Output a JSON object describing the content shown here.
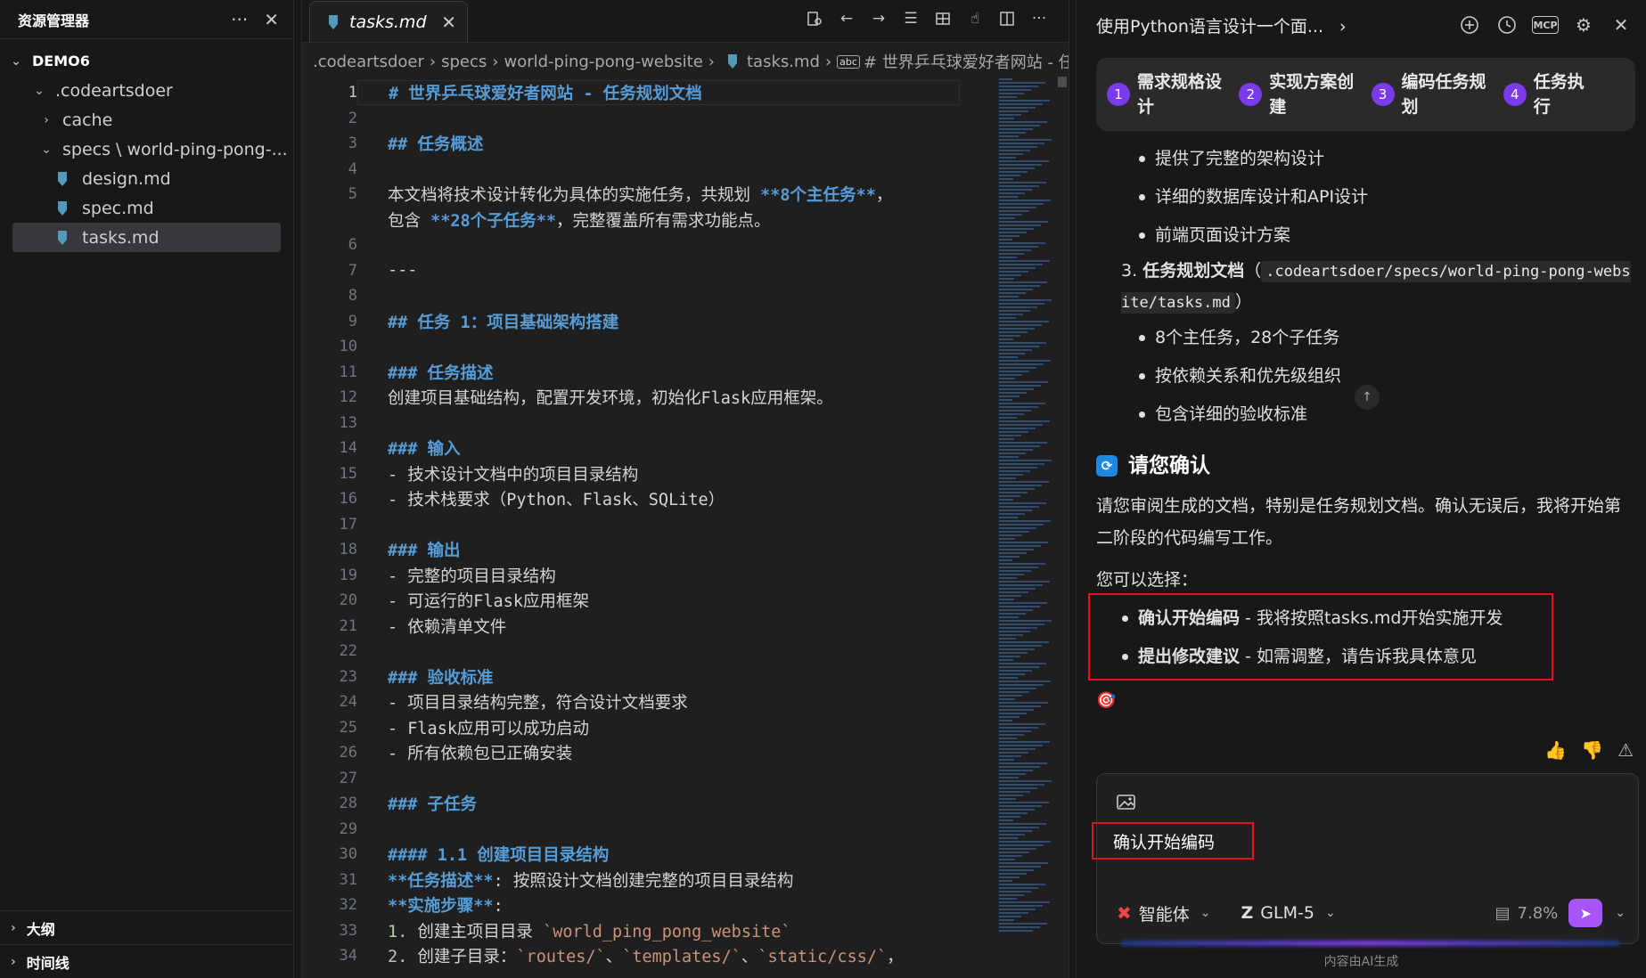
{
  "explorer": {
    "title": "资源管理器",
    "more": "···",
    "close": "✕",
    "root": "DEMO6",
    "items": [
      {
        "label": ".codeartsdoer",
        "kind": "folder-open",
        "indent": 1
      },
      {
        "label": "cache",
        "kind": "folder-closed",
        "indent": 2
      },
      {
        "label": "specs \\ world-ping-pong-...",
        "kind": "folder-open",
        "indent": 2
      },
      {
        "label": "design.md",
        "kind": "file",
        "indent": 3
      },
      {
        "label": "spec.md",
        "kind": "file",
        "indent": 3
      },
      {
        "label": "tasks.md",
        "kind": "file",
        "indent": 3,
        "selected": true
      }
    ],
    "outline": "大纲",
    "timeline": "时间线"
  },
  "editor": {
    "tab_label": "tasks.md",
    "breadcrumb": [
      ".codeartsdoer",
      "specs",
      "world-ping-pong-website",
      "tasks.md",
      "# 世界乒乓球爱好者网站 - 任务"
    ],
    "lines": [
      {
        "n": "1",
        "segs": [
          {
            "t": "# 世界乒乓球爱好者网站 - 任务规划文档",
            "c": "h"
          }
        ]
      },
      {
        "n": "2",
        "segs": []
      },
      {
        "n": "3",
        "segs": [
          {
            "t": "## 任务概述",
            "c": "h"
          }
        ]
      },
      {
        "n": "4",
        "segs": []
      },
      {
        "n": "5",
        "segs": [
          {
            "t": "本文档将技术设计转化为具体的实施任务，共规划 ",
            "c": ""
          },
          {
            "t": "**8个主任务**",
            "c": "b"
          },
          {
            "t": "，",
            "c": ""
          }
        ]
      },
      {
        "n": "",
        "segs": [
          {
            "t": "包含 ",
            "c": ""
          },
          {
            "t": "**28个子任务**",
            "c": "b"
          },
          {
            "t": "，完整覆盖所有需求功能点。",
            "c": ""
          }
        ]
      },
      {
        "n": "6",
        "segs": []
      },
      {
        "n": "7",
        "segs": [
          {
            "t": "---",
            "c": ""
          }
        ]
      },
      {
        "n": "8",
        "segs": []
      },
      {
        "n": "9",
        "segs": [
          {
            "t": "## 任务 1：项目基础架构搭建",
            "c": "h"
          }
        ]
      },
      {
        "n": "10",
        "segs": []
      },
      {
        "n": "11",
        "segs": [
          {
            "t": "### 任务描述",
            "c": "h"
          }
        ]
      },
      {
        "n": "12",
        "segs": [
          {
            "t": "创建项目基础结构，配置开发环境，初始化Flask应用框架。",
            "c": ""
          }
        ]
      },
      {
        "n": "13",
        "segs": []
      },
      {
        "n": "14",
        "segs": [
          {
            "t": "### 输入",
            "c": "h"
          }
        ]
      },
      {
        "n": "15",
        "segs": [
          {
            "t": "- 技术设计文档中的项目目录结构",
            "c": ""
          }
        ]
      },
      {
        "n": "16",
        "segs": [
          {
            "t": "- 技术栈要求（Python、Flask、SQLite）",
            "c": ""
          }
        ]
      },
      {
        "n": "17",
        "segs": []
      },
      {
        "n": "18",
        "segs": [
          {
            "t": "### 输出",
            "c": "h"
          }
        ]
      },
      {
        "n": "19",
        "segs": [
          {
            "t": "- 完整的项目目录结构",
            "c": ""
          }
        ]
      },
      {
        "n": "20",
        "segs": [
          {
            "t": "- 可运行的Flask应用框架",
            "c": ""
          }
        ]
      },
      {
        "n": "21",
        "segs": [
          {
            "t": "- 依赖清单文件",
            "c": ""
          }
        ]
      },
      {
        "n": "22",
        "segs": []
      },
      {
        "n": "23",
        "segs": [
          {
            "t": "### 验收标准",
            "c": "h"
          }
        ]
      },
      {
        "n": "24",
        "segs": [
          {
            "t": "- 项目目录结构完整，符合设计文档要求",
            "c": ""
          }
        ]
      },
      {
        "n": "25",
        "segs": [
          {
            "t": "- Flask应用可以成功启动",
            "c": ""
          }
        ]
      },
      {
        "n": "26",
        "segs": [
          {
            "t": "- 所有依赖包已正确安装",
            "c": ""
          }
        ]
      },
      {
        "n": "27",
        "segs": []
      },
      {
        "n": "28",
        "segs": [
          {
            "t": "### 子任务",
            "c": "h"
          }
        ]
      },
      {
        "n": "29",
        "segs": []
      },
      {
        "n": "30",
        "segs": [
          {
            "t": "#### 1.1 创建项目目录结构",
            "c": "h"
          }
        ]
      },
      {
        "n": "31",
        "segs": [
          {
            "t": "**任务描述**",
            "c": "b"
          },
          {
            "t": ": 按照设计文档创建完整的项目目录结构",
            "c": ""
          }
        ]
      },
      {
        "n": "32",
        "segs": [
          {
            "t": "**实施步骤**",
            "c": "b"
          },
          {
            "t": ":",
            "c": ""
          }
        ]
      },
      {
        "n": "33",
        "segs": [
          {
            "t": "1.",
            "c": "num"
          },
          {
            "t": " 创建主项目目录 ",
            "c": ""
          },
          {
            "t": "`world_ping_pong_website`",
            "c": "tk"
          }
        ]
      },
      {
        "n": "34",
        "segs": [
          {
            "t": "2.",
            "c": "num"
          },
          {
            "t": " 创建子目录：",
            "c": ""
          },
          {
            "t": "`routes/`",
            "c": "tk"
          },
          {
            "t": "、",
            "c": ""
          },
          {
            "t": "`templates/`",
            "c": "tk"
          },
          {
            "t": "、",
            "c": ""
          },
          {
            "t": "`static/css/`",
            "c": "tk"
          },
          {
            "t": "，",
            "c": ""
          }
        ]
      }
    ]
  },
  "chat": {
    "title": "使用Python语言设计一个面...",
    "steps": [
      {
        "n": "1",
        "label": "需求规格设计"
      },
      {
        "n": "2",
        "label": "实现方案创建"
      },
      {
        "n": "3",
        "label": "编码任务规划"
      },
      {
        "n": "4",
        "label": "任务执行"
      }
    ],
    "bullets_top": [
      "提供了完整的架构设计",
      "详细的数据库设计和API设计",
      "前端页面设计方案"
    ],
    "item3_prefix": "3.",
    "item3_title": "任务规划文档",
    "item3_open": "（",
    "item3_code": ".codeartsdoer/specs/world-ping-pong-website/tasks.md",
    "item3_close": "）",
    "bullets_item3": [
      "8个主任务，28个子任务",
      "按依赖关系和优先级组织",
      "包含详细的验收标准"
    ],
    "confirm_title": "请您确认",
    "confirm_text": "请您审阅生成的文档，特别是任务规划文档。确认无误后，我将开始第二阶段的代码编写工作。",
    "choose_label": "您可以选择：",
    "options": [
      {
        "bold": "确认开始编码",
        "rest": " - 我将按照tasks.md开始实施开发"
      },
      {
        "bold": "提出修改建议",
        "rest": " - 如需调整，请告诉我具体意见"
      }
    ],
    "input_value": "确认开始编码",
    "agent_label": "智能体",
    "model_label": "GLM-5",
    "context_pct": "7.8%",
    "footer": "内容由AI生成"
  }
}
